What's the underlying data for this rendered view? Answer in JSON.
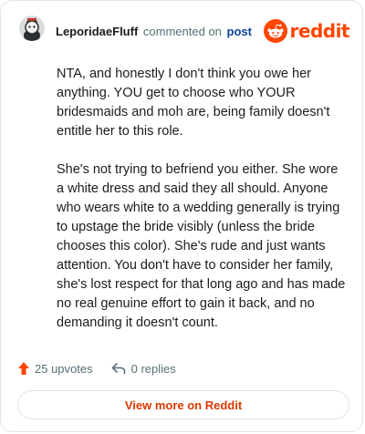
{
  "comment": {
    "author": "LeporidaeFluff",
    "action_text": "commented on",
    "post_link_text": "post",
    "paragraphs": [
      "NTA, and honestly I don't think you owe her anything. YOU get to choose who YOUR bridesmaids and moh are, being family doesn't entitle her to this role.",
      "She's not trying to befriend you either. She wore a white dress and said they all should. Anyone who wears white to a wedding generally is trying to upstage the bride visibly (unless the bride chooses this color). She's rude and just wants attention. You don't have to consider her family, she's lost respect for that long ago and has made no real genuine effort to gain it back, and no demanding it doesn't count."
    ]
  },
  "brand": {
    "wordmark": "reddit",
    "icon": "reddit-logo-icon",
    "color": "#ff4500"
  },
  "footer": {
    "upvotes_label": "25 upvotes",
    "upvote_icon": "upvote-arrow-icon",
    "upvote_color": "#ff4500",
    "replies_label": "0 replies",
    "reply_icon": "reply-arrow-icon"
  },
  "view_more_label": "View more on Reddit"
}
